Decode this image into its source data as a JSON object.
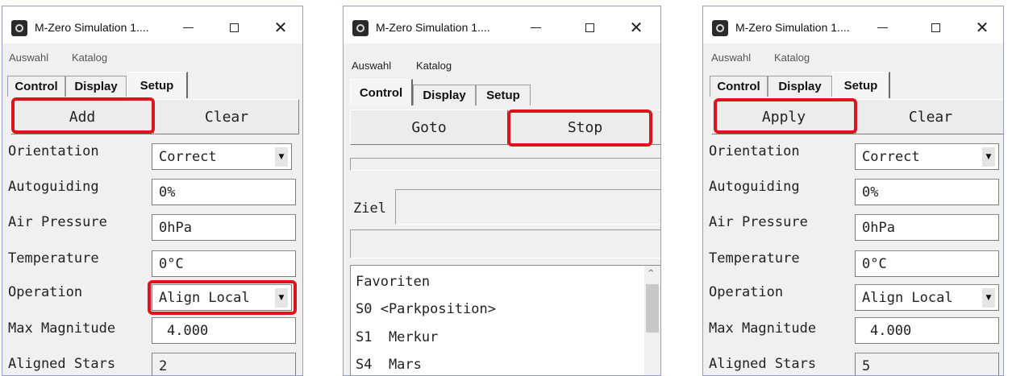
{
  "colors": {
    "highlight": "#e0121b",
    "window_border": "#9a9cc8"
  },
  "windows": [
    {
      "title": "M-Zero Simulation 1....",
      "menu": [
        "Auswahl",
        "Katalog"
      ],
      "tabs": [
        "Control",
        "Display",
        "Setup"
      ],
      "active_tab": "Setup",
      "buttons": [
        "Add",
        "Clear"
      ],
      "fields": {
        "orientation": {
          "label": "Orientation",
          "value": "Correct"
        },
        "autoguiding": {
          "label": "Autoguiding",
          "value": "0%"
        },
        "air_pressure": {
          "label": "Air Pressure",
          "value": "0hPa"
        },
        "temperature": {
          "label": "Temperature",
          "value": "0°C"
        },
        "operation": {
          "label": "Operation",
          "value": "Align Local"
        },
        "max_magnitude": {
          "label": "Max Magnitude",
          "value": "4.000"
        },
        "aligned_stars": {
          "label": "Aligned Stars",
          "value": "2"
        }
      }
    },
    {
      "title": "M-Zero Simulation 1....",
      "menu": [
        "Auswahl",
        "Katalog"
      ],
      "tabs": [
        "Control",
        "Display",
        "Setup"
      ],
      "active_tab": "Control",
      "buttons": [
        "Goto",
        "Stop"
      ],
      "ziel_label": "Ziel",
      "list": [
        "Favoriten",
        "S0 <Parkposition>",
        "S1  Merkur",
        "S4  Mars"
      ]
    },
    {
      "title": "M-Zero Simulation 1....",
      "menu": [
        "Auswahl",
        "Katalog"
      ],
      "tabs": [
        "Control",
        "Display",
        "Setup"
      ],
      "active_tab": "Setup",
      "buttons": [
        "Apply",
        "Clear"
      ],
      "fields": {
        "orientation": {
          "label": "Orientation",
          "value": "Correct"
        },
        "autoguiding": {
          "label": "Autoguiding",
          "value": "0%"
        },
        "air_pressure": {
          "label": "Air Pressure",
          "value": "0hPa"
        },
        "temperature": {
          "label": "Temperature",
          "value": "0°C"
        },
        "operation": {
          "label": "Operation",
          "value": "Align Local"
        },
        "max_magnitude": {
          "label": "Max Magnitude",
          "value": "4.000"
        },
        "aligned_stars": {
          "label": "Aligned Stars",
          "value": "5"
        }
      }
    }
  ]
}
